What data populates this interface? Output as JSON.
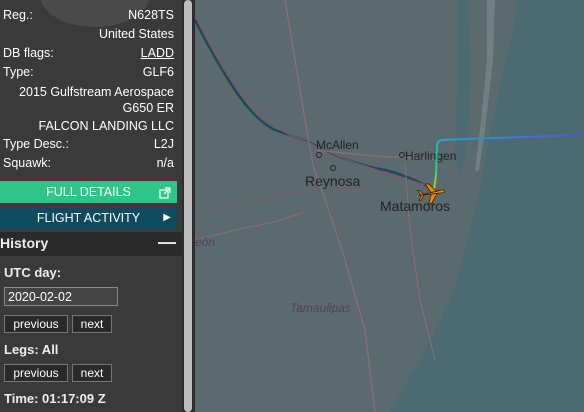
{
  "aircraft": {
    "reg_label": "Reg.:",
    "reg": "N628TS",
    "country": "United States",
    "db_flags_label": "DB flags:",
    "db_flags": "LADD",
    "type_label": "Type:",
    "type": "GLF6",
    "model_line1": "2015 Gulfstream Aerospace",
    "model_line2": "G650 ER",
    "owner": "FALCON LANDING LLC",
    "type_desc_label": "Type Desc.:",
    "type_desc": "L2J",
    "squawk_label": "Squawk:",
    "squawk": "n/a"
  },
  "buttons": {
    "full_details": "FULL DETAILS",
    "flight_activity": "FLIGHT ACTIVITY"
  },
  "history": {
    "title": "History",
    "utc_day_label": "UTC day:",
    "utc_day_value": "2020-02-02",
    "previous": "previous",
    "next": "next",
    "legs_label": "Legs: All",
    "time_label": "Time: 01:17:09 Z"
  },
  "map": {
    "places": {
      "mcallen": "McAllen",
      "harlingen": "Harlingen",
      "reynosa": "Reynosa",
      "matamoros": "Matamoros",
      "tamaulipas": "Tamaulipas",
      "leon": "eón"
    },
    "colors": {
      "land": "#5b6a6e",
      "water": "#4b6a72",
      "aircraft": "#f08a00",
      "track_start": "#5b4fd8",
      "track_end": "#c8d400"
    }
  }
}
